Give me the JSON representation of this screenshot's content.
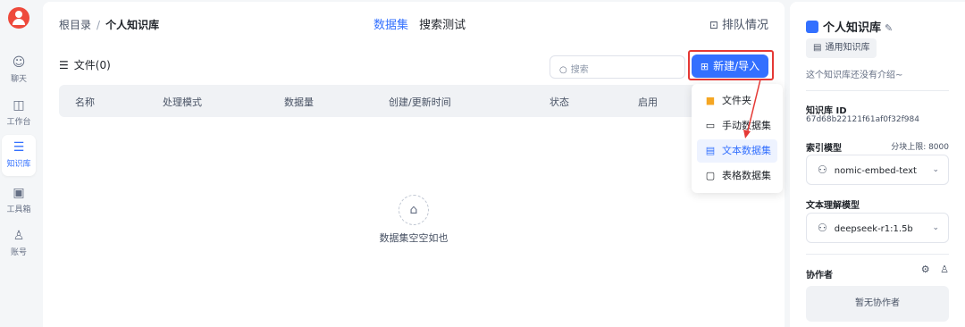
{
  "nav": {
    "items": [
      {
        "label": "聊天",
        "icon": "chat-icon"
      },
      {
        "label": "工作台",
        "icon": "robot-icon"
      },
      {
        "label": "知识库",
        "icon": "database-icon",
        "active": true
      },
      {
        "label": "工具箱",
        "icon": "toolbox-icon"
      },
      {
        "label": "账号",
        "icon": "user-icon"
      }
    ]
  },
  "breadcrumb": {
    "root": "根目录",
    "sep": "/",
    "current": "个人知识库"
  },
  "tabs": [
    {
      "label": "数据集",
      "active": true
    },
    {
      "label": "搜索测试",
      "active": false
    }
  ],
  "queue_label": "排队情况",
  "files_label": "文件(0)",
  "search": {
    "placeholder": "搜索"
  },
  "new_button": "新建/导入",
  "table_headers": [
    "名称",
    "处理模式",
    "数据量",
    "创建/更新时间",
    "状态",
    "启用"
  ],
  "empty_text": "数据集空空如也",
  "menu": {
    "items": [
      {
        "label": "文件夹",
        "icon": "folder-icon",
        "active": false
      },
      {
        "label": "手动数据集",
        "icon": "manual-dataset-icon",
        "active": false
      },
      {
        "label": "文本数据集",
        "icon": "text-dataset-icon",
        "active": true
      },
      {
        "label": "表格数据集",
        "icon": "table-dataset-icon",
        "active": false
      }
    ]
  },
  "side": {
    "title": "个人知识库",
    "tag": "通用知识库",
    "desc": "这个知识库还没有介绍~",
    "kb_id_label": "知识库 ID",
    "kb_id": "67d68b22121f61af0f32f984",
    "index_model_label": "索引模型",
    "chunk_limit": "分块上限: 8000",
    "index_model": "nomic-embed-text",
    "text_model_label": "文本理解模型",
    "text_model": "deepseek-r1:1.5b",
    "collab_label": "协作者",
    "no_collab": "暂无协作者"
  },
  "colors": {
    "accent": "#3370ff",
    "highlight": "#e53935",
    "avatar": "#ee4a3c"
  }
}
